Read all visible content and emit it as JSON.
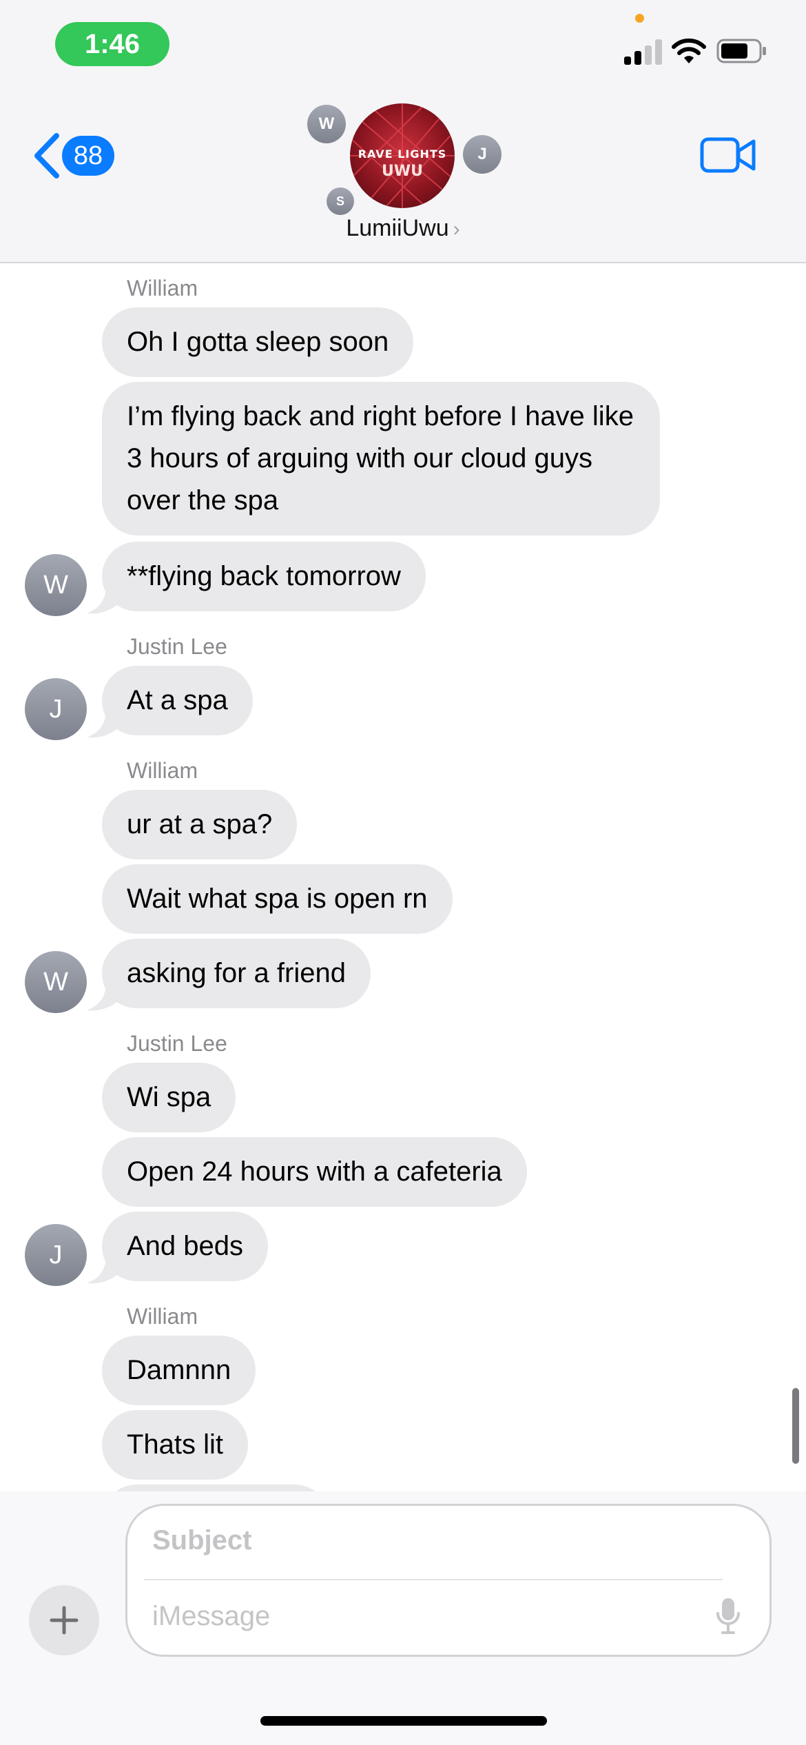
{
  "status_bar": {
    "time": "1:46"
  },
  "header": {
    "back_count": "88",
    "group_name": "LumiiUwu",
    "group_avatar_text_top": "RAVE LIGHTS",
    "group_avatar_text_bottom": "UWU",
    "members": [
      "W",
      "J",
      "S"
    ]
  },
  "thread": {
    "groups": [
      {
        "sender": "William",
        "avatar": "W",
        "messages": [
          "Oh I gotta sleep soon",
          "I’m flying back and right before I have like 3 hours of arguing with our cloud guys over the spa",
          "**flying back tomorrow"
        ]
      },
      {
        "sender": "Justin Lee",
        "avatar": "J",
        "messages": [
          "At a spa"
        ]
      },
      {
        "sender": "William",
        "avatar": "W",
        "messages": [
          "ur at a spa?",
          "Wait what spa is open rn",
          "asking for a friend"
        ]
      },
      {
        "sender": "Justin Lee",
        "avatar": "J",
        "messages": [
          "Wi spa",
          "Open 24 hours with a cafeteria",
          "And beds"
        ]
      },
      {
        "sender": "William",
        "avatar": "W",
        "messages": [
          "Damnnn",
          "Thats lit"
        ]
      }
    ]
  },
  "compose": {
    "subject_placeholder": "Subject",
    "message_placeholder": "iMessage"
  },
  "colors": {
    "accent": "#0a7cff",
    "time_pill": "#34c759",
    "bubble": "#e9e9eb"
  }
}
